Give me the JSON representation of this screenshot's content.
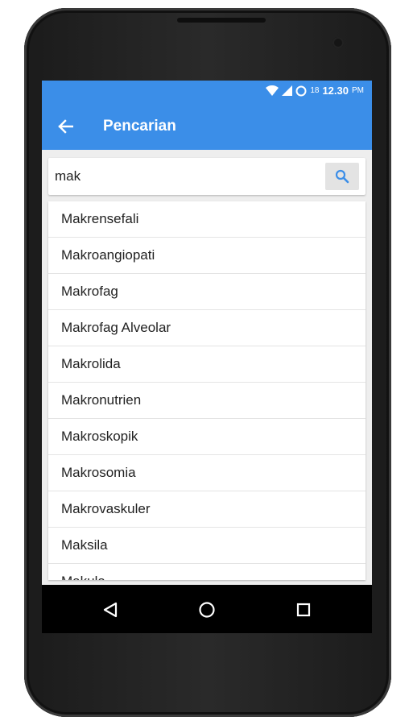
{
  "status_bar": {
    "network_label": "18",
    "time": "12.30",
    "period": "PM"
  },
  "app_bar": {
    "title": "Pencarian"
  },
  "search": {
    "value": "mak"
  },
  "results": [
    "Makrensefali",
    "Makroangiopati",
    "Makrofag",
    "Makrofag Alveolar",
    "Makrolida",
    "Makronutrien",
    "Makroskopik",
    "Makrosomia",
    "Makrovaskuler",
    "Maksila",
    "Makula"
  ],
  "colors": {
    "primary": "#3b8ee8",
    "search_icon": "#3b8ee8"
  },
  "icons": {
    "back": "arrow-left-icon",
    "search": "search-icon",
    "nav_back": "triangle-back-icon",
    "nav_home": "circle-home-icon",
    "nav_recents": "square-recents-icon"
  }
}
